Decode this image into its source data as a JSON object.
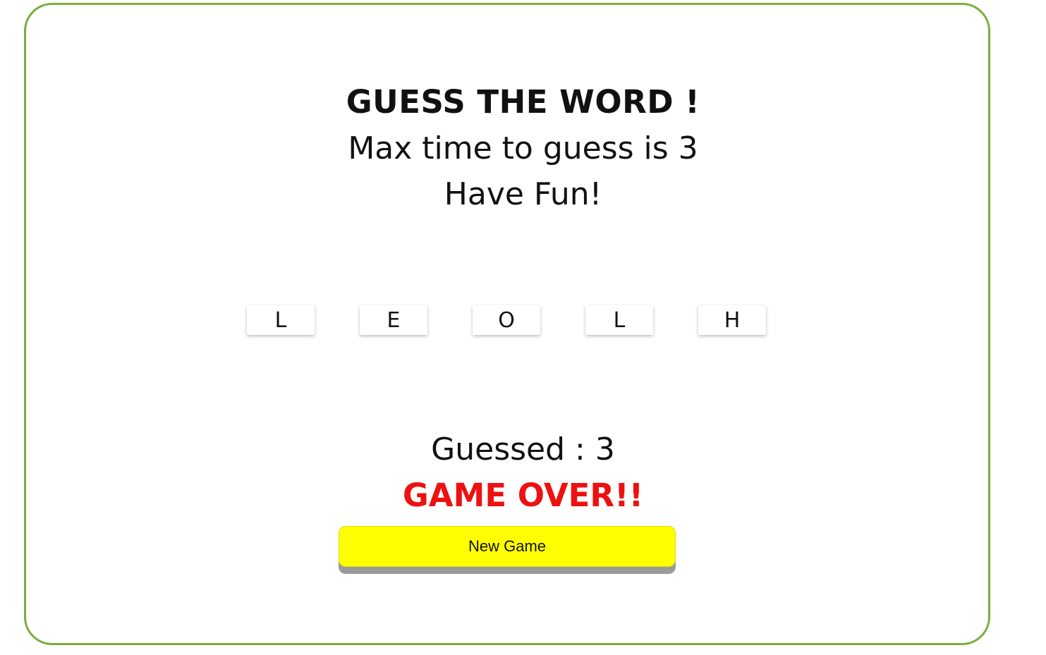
{
  "game": {
    "title": "GUESS THE WORD !",
    "subtitle": "Max time to guess is 3",
    "tagline": "Have Fun!",
    "tiles": [
      {
        "letter": "L"
      },
      {
        "letter": "E"
      },
      {
        "letter": "O"
      },
      {
        "letter": "L"
      },
      {
        "letter": "H"
      }
    ],
    "guessed_text": "Guessed : 3",
    "status_text": "GAME OVER!!",
    "new_game_label": "New Game"
  },
  "colors": {
    "border": "#7cac3c",
    "status": "#ee1111",
    "button": "#ffff00",
    "button_shadow": "#9a9a9a"
  }
}
